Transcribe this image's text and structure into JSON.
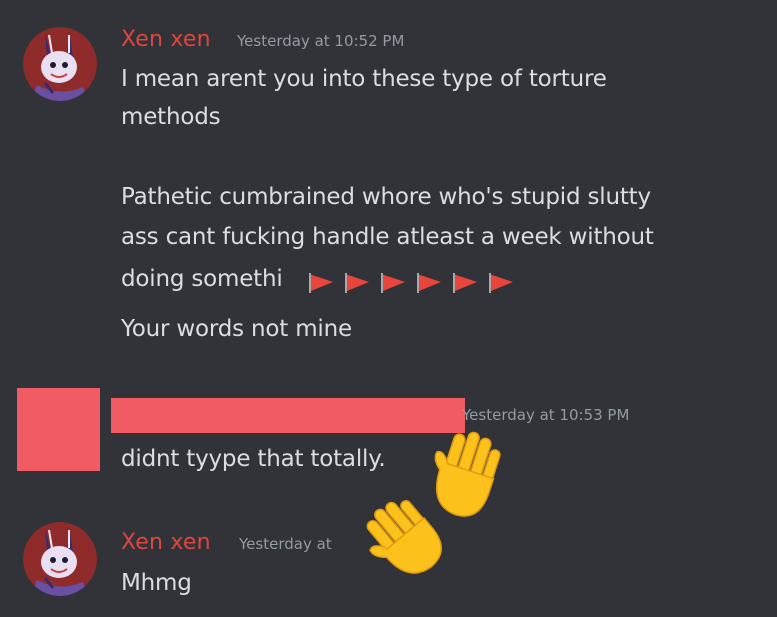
{
  "messages": [
    {
      "username": "Xen xen",
      "timestamp": "Yesterday at 10:52 PM",
      "lines": [
        "I mean arent you into these type of  torture",
        "methods",
        "Pathetic cumbrained whore who's stupid  slutty",
        "ass cant fucking handle atleast a week without",
        "doing somethi",
        "Your words not mine"
      ],
      "flag_emoji_count": 6
    },
    {
      "username": "",
      "timestamp": "Yesterday at 10:53 PM",
      "lines": [
        "didnt tyype that totally."
      ]
    },
    {
      "username": "Xen xen",
      "timestamp": "Yesterday at",
      "lines": [
        "Mhmg"
      ]
    }
  ],
  "overlay_emoji": "waving-hand",
  "colors": {
    "background": "#313338",
    "username": "#e0453f",
    "message_text": "#dbdee1",
    "timestamp": "#949ba4",
    "redaction": "#f15b63",
    "flag": "#e8453c"
  }
}
